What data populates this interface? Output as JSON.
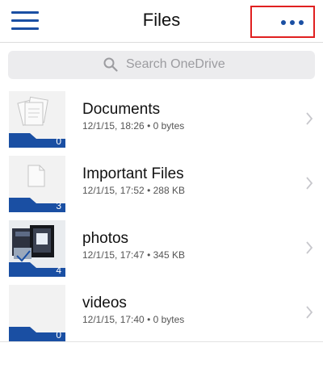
{
  "header": {
    "title": "Files",
    "menu_icon": "hamburger-icon",
    "more_icon": "more-dots-icon"
  },
  "search": {
    "placeholder": "Search OneDrive",
    "icon": "search-icon"
  },
  "colors": {
    "accent": "#1a4fa3",
    "highlight_box": "#e02020",
    "search_bg": "#ececee"
  },
  "folders": [
    {
      "name": "Documents",
      "meta": "12/1/15, 18:26 • 0 bytes",
      "count": "0",
      "thumb": "documents-thumbnail"
    },
    {
      "name": "Important Files",
      "meta": "12/1/15, 17:52 • 288 KB",
      "count": "3",
      "thumb": "file-thumbnail"
    },
    {
      "name": "photos",
      "meta": "12/1/15, 17:47 • 345 KB",
      "count": "4",
      "thumb": "photo-thumbnail"
    },
    {
      "name": "videos",
      "meta": "12/1/15, 17:40 • 0 bytes",
      "count": "0",
      "thumb": "empty-thumbnail"
    }
  ]
}
